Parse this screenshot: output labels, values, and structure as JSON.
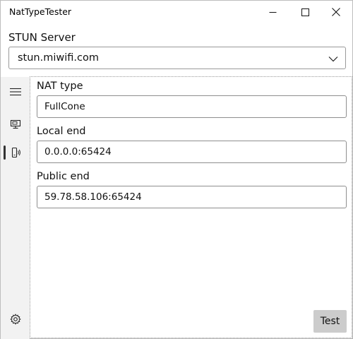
{
  "window": {
    "title": "NatTypeTester",
    "controls": {
      "minimize": "minimize-icon",
      "maximize": "maximize-icon",
      "close": "close-icon"
    }
  },
  "stun": {
    "label": "STUN Server",
    "selected": "stun.miwifi.com"
  },
  "nav": {
    "items": [
      {
        "icon": "hamburger-menu-icon"
      },
      {
        "icon": "monitor-icon"
      },
      {
        "icon": "nat-results-icon",
        "selected": true
      },
      {
        "icon": "gear-icon"
      }
    ]
  },
  "results": {
    "nat_type_label": "NAT type",
    "nat_type_value": "FullCone",
    "local_end_label": "Local end",
    "local_end_value": "0.0.0.0:65424",
    "public_end_label": "Public end",
    "public_end_value": "59.78.58.106:65424"
  },
  "actions": {
    "test_label": "Test"
  }
}
